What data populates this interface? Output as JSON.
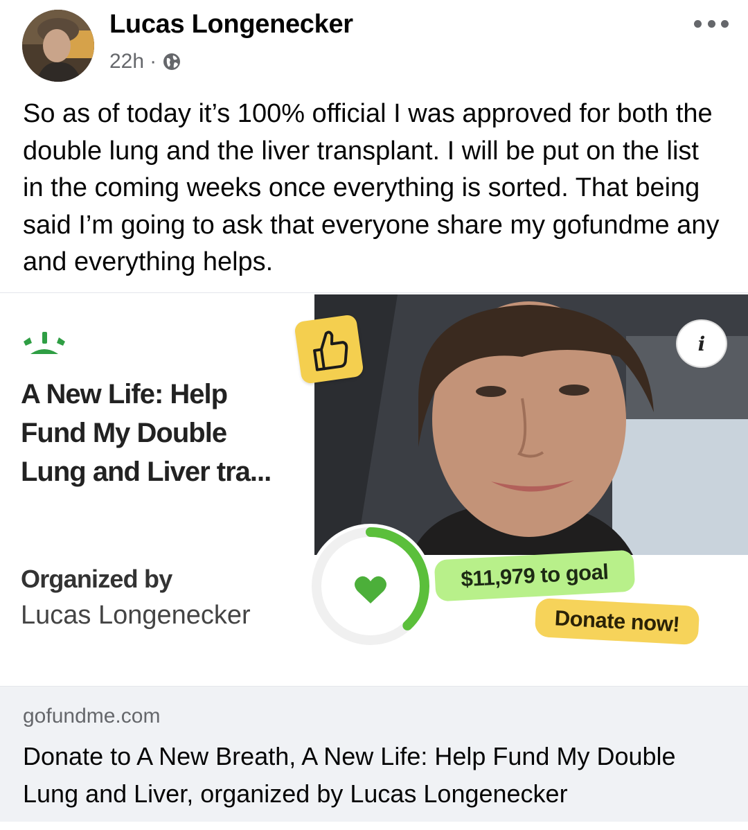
{
  "post": {
    "author": "Lucas Longenecker",
    "time": "22h",
    "separator": "·",
    "audience_icon": "globe-icon",
    "text": "So as of today it’s 100% official I was approved for both the double lung and the liver transplant. I will be put on the list in the coming weeks once everything is sorted. That being said I’m going to ask that everyone share my gofundme any and everything helps."
  },
  "card": {
    "title": "A New Life: Help Fund My Double Lung and Liver tra...",
    "organized_label": "Organized by",
    "organizer": "Lucas Longenecker",
    "goal_text": "$11,979 to goal",
    "donate_label": "Donate now!",
    "info_label": "i",
    "progress_fraction": 0.38,
    "colors": {
      "green": "#5bbf3b",
      "goal_pill": "#b8f08a",
      "donate_pill": "#f6d35a",
      "thumb_tile": "#f4cf4f"
    }
  },
  "link": {
    "domain": "gofundme.com",
    "title": "Donate to A New Breath, A New Life: Help Fund My Double Lung and Liver, organized by Lucas Longenecker"
  }
}
